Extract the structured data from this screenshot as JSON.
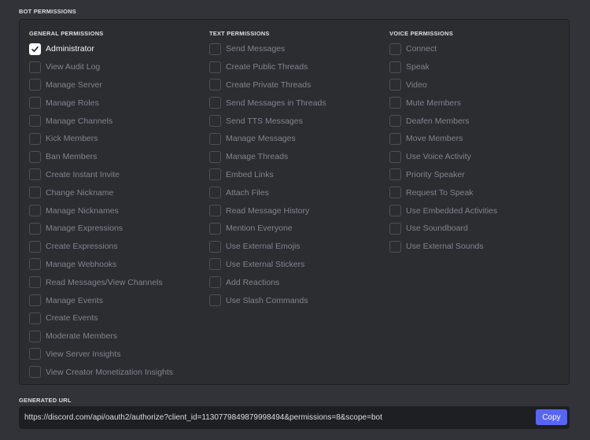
{
  "sections": {
    "bot_permissions": "BOT PERMISSIONS",
    "generated_url": "GENERATED URL"
  },
  "columns": {
    "general": {
      "header": "GENERAL PERMISSIONS",
      "items": [
        {
          "label": "Administrator",
          "checked": true
        },
        {
          "label": "View Audit Log",
          "checked": false
        },
        {
          "label": "Manage Server",
          "checked": false
        },
        {
          "label": "Manage Roles",
          "checked": false
        },
        {
          "label": "Manage Channels",
          "checked": false
        },
        {
          "label": "Kick Members",
          "checked": false
        },
        {
          "label": "Ban Members",
          "checked": false
        },
        {
          "label": "Create Instant Invite",
          "checked": false
        },
        {
          "label": "Change Nickname",
          "checked": false
        },
        {
          "label": "Manage Nicknames",
          "checked": false
        },
        {
          "label": "Manage Expressions",
          "checked": false
        },
        {
          "label": "Create Expressions",
          "checked": false
        },
        {
          "label": "Manage Webhooks",
          "checked": false
        },
        {
          "label": "Read Messages/View Channels",
          "checked": false
        },
        {
          "label": "Manage Events",
          "checked": false
        },
        {
          "label": "Create Events",
          "checked": false
        },
        {
          "label": "Moderate Members",
          "checked": false
        },
        {
          "label": "View Server Insights",
          "checked": false
        },
        {
          "label": "View Creator Monetization Insights",
          "checked": false
        }
      ]
    },
    "text": {
      "header": "TEXT PERMISSIONS",
      "items": [
        {
          "label": "Send Messages",
          "checked": false
        },
        {
          "label": "Create Public Threads",
          "checked": false
        },
        {
          "label": "Create Private Threads",
          "checked": false
        },
        {
          "label": "Send Messages in Threads",
          "checked": false
        },
        {
          "label": "Send TTS Messages",
          "checked": false
        },
        {
          "label": "Manage Messages",
          "checked": false
        },
        {
          "label": "Manage Threads",
          "checked": false
        },
        {
          "label": "Embed Links",
          "checked": false
        },
        {
          "label": "Attach Files",
          "checked": false
        },
        {
          "label": "Read Message History",
          "checked": false
        },
        {
          "label": "Mention Everyone",
          "checked": false
        },
        {
          "label": "Use External Emojis",
          "checked": false
        },
        {
          "label": "Use External Stickers",
          "checked": false
        },
        {
          "label": "Add Reactions",
          "checked": false
        },
        {
          "label": "Use Slash Commands",
          "checked": false
        }
      ]
    },
    "voice": {
      "header": "VOICE PERMISSIONS",
      "items": [
        {
          "label": "Connect",
          "checked": false
        },
        {
          "label": "Speak",
          "checked": false
        },
        {
          "label": "Video",
          "checked": false
        },
        {
          "label": "Mute Members",
          "checked": false
        },
        {
          "label": "Deafen Members",
          "checked": false
        },
        {
          "label": "Move Members",
          "checked": false
        },
        {
          "label": "Use Voice Activity",
          "checked": false
        },
        {
          "label": "Priority Speaker",
          "checked": false
        },
        {
          "label": "Request To Speak",
          "checked": false
        },
        {
          "label": "Use Embedded Activities",
          "checked": false
        },
        {
          "label": "Use Soundboard",
          "checked": false
        },
        {
          "label": "Use External Sounds",
          "checked": false
        }
      ]
    }
  },
  "generated": {
    "url": "https://discord.com/api/oauth2/authorize?client_id=1130779849879998494&permissions=8&scope=bot",
    "copy_label": "Copy"
  },
  "colors": {
    "background": "#313338",
    "panel": "#2b2d31",
    "input": "#1e1f22",
    "accent": "#5865f2",
    "checked": "#ffffff"
  },
  "icons": {
    "checkmark": "check-icon"
  }
}
